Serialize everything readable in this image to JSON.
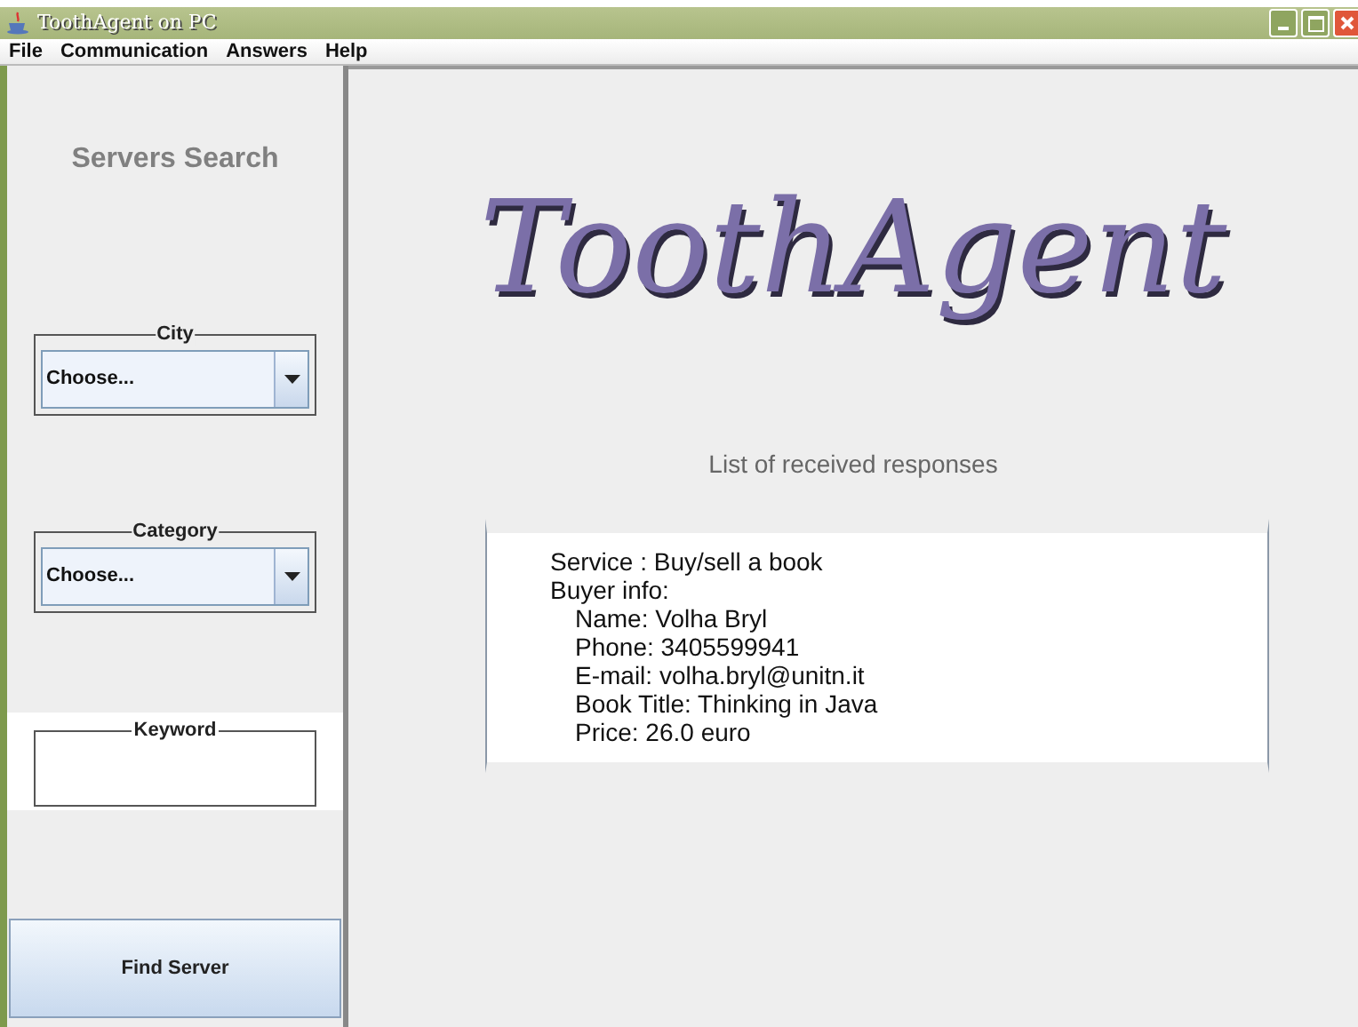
{
  "window": {
    "title": "ToothAgent on PC"
  },
  "menu": [
    "File",
    "Communication",
    "Answers",
    "Help"
  ],
  "sidebar": {
    "title": "Servers Search",
    "city": {
      "label": "City",
      "value": "Choose..."
    },
    "category": {
      "label": "Category",
      "value": "Choose..."
    },
    "keyword": {
      "label": "Keyword"
    },
    "button": "Find Server"
  },
  "main": {
    "logo": "ToothAgent",
    "list_title": "List of received responses",
    "responses": [
      {
        "text": "Service : Buy/sell a book"
      },
      {
        "text": "Buyer info:",
        "children": [
          {
            "text": "Name: Volha Bryl"
          },
          {
            "text": "Phone: 3405599941"
          },
          {
            "text": "E-mail: volha.bryl@unitn.it"
          },
          {
            "text": "Book Title: Thinking in Java"
          },
          {
            "text": "Price: 26.0 euro"
          }
        ]
      }
    ]
  }
}
